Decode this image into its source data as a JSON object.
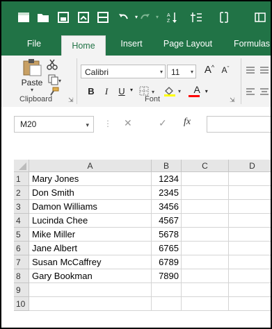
{
  "quick_access": {
    "icons": [
      "excel-icon",
      "open-icon",
      "save-icon",
      "save-as-icon",
      "form-icon",
      "undo-icon",
      "redo-icon",
      "sort-icon",
      "filter-icon",
      "freeze-icon",
      "more-icon"
    ]
  },
  "tabs": [
    {
      "label": "File",
      "active": false
    },
    {
      "label": "Home",
      "active": true
    },
    {
      "label": "Insert",
      "active": false
    },
    {
      "label": "Page Layout",
      "active": false
    },
    {
      "label": "Formulas",
      "active": false
    }
  ],
  "ribbon": {
    "clipboard": {
      "paste_label": "Paste",
      "group_label": "Clipboard"
    },
    "font": {
      "font_name": "Calibri",
      "font_size": "11",
      "bold": "B",
      "italic": "I",
      "underline": "U",
      "group_label": "Font",
      "grow_label": "A",
      "shrink_label": "A",
      "font_color_label": "A"
    }
  },
  "formula_bar": {
    "name_box": "M20",
    "cancel_symbol": "✕",
    "enter_symbol": "✓",
    "fx_symbol": "fx",
    "value": ""
  },
  "sheet": {
    "columns": [
      "A",
      "B",
      "C",
      "D"
    ],
    "rows": [
      {
        "num": "1",
        "a": "Mary Jones",
        "b": "1234"
      },
      {
        "num": "2",
        "a": "Don Smith",
        "b": "2345"
      },
      {
        "num": "3",
        "a": "Damon Williams",
        "b": "3456"
      },
      {
        "num": "4",
        "a": "Lucinda Chee",
        "b": "4567"
      },
      {
        "num": "5",
        "a": "Mike Miller",
        "b": "5678"
      },
      {
        "num": "6",
        "a": "Jane Albert",
        "b": "6765"
      },
      {
        "num": "7",
        "a": "Susan McCaffrey",
        "b": "6789"
      },
      {
        "num": "8",
        "a": "Gary Bookman",
        "b": "7890"
      },
      {
        "num": "9",
        "a": "",
        "b": ""
      },
      {
        "num": "10",
        "a": "",
        "b": ""
      }
    ]
  },
  "colors": {
    "accent": "#217346",
    "ribbon_bg": "#f3f3f3",
    "header_bg": "#e6e6e6",
    "font_color_bar": "#ff0000",
    "fill_color_bar": "#ffff00"
  }
}
